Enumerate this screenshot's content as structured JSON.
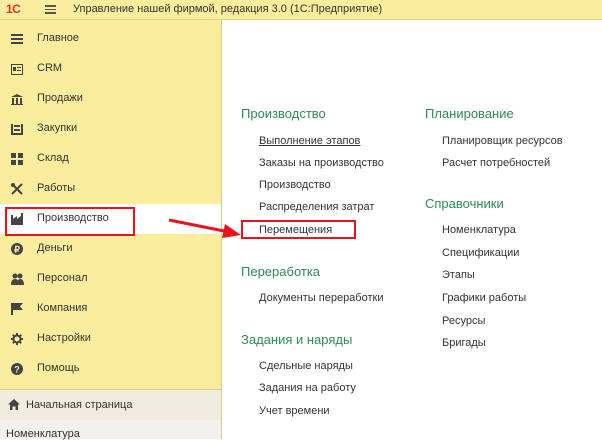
{
  "window": {
    "logo": "1С",
    "title": "Управление нашей фирмой, редакция 3.0  (1С:Предприятие)"
  },
  "sidebar": {
    "items": [
      {
        "label": "Главное",
        "icon": "menu-lines-icon"
      },
      {
        "label": "CRM",
        "icon": "contact-card-icon"
      },
      {
        "label": "Продажи",
        "icon": "shop-icon"
      },
      {
        "label": "Закупки",
        "icon": "cart-icon"
      },
      {
        "label": "Склад",
        "icon": "warehouse-grid-icon"
      },
      {
        "label": "Работы",
        "icon": "tools-icon"
      },
      {
        "label": "Производство",
        "icon": "factory-icon",
        "active": true
      },
      {
        "label": "Деньги",
        "icon": "coin-icon"
      },
      {
        "label": "Персонал",
        "icon": "people-icon"
      },
      {
        "label": "Компания",
        "icon": "flag-icon"
      },
      {
        "label": "Настройки",
        "icon": "gear-icon"
      },
      {
        "label": "Помощь",
        "icon": "help-icon"
      }
    ],
    "home": "Начальная страница",
    "recent": "Номенклатура"
  },
  "content": {
    "left": {
      "production": {
        "title": "Производство",
        "links": [
          "Выполнение этапов",
          "Заказы на производство",
          "Производство",
          "Распределения затрат",
          "Перемещения"
        ]
      },
      "processing": {
        "title": "Переработка",
        "links": [
          "Документы переработки"
        ]
      },
      "tasks": {
        "title": "Задания и наряды",
        "links": [
          "Сдельные наряды",
          "Задания на работу",
          "Учет времени"
        ]
      }
    },
    "right": {
      "planning": {
        "title": "Планирование",
        "links": [
          "Планировщик ресурсов",
          "Расчет потребностей"
        ]
      },
      "references": {
        "title": "Справочники",
        "links": [
          "Номенклатура",
          "Спецификации",
          "Этапы",
          "Графики работы",
          "Ресурсы",
          "Бригады"
        ]
      }
    }
  },
  "colors": {
    "accent_green": "#2e8a57",
    "panel_yellow": "#fbed9e",
    "highlight_red": "#e8141d"
  }
}
